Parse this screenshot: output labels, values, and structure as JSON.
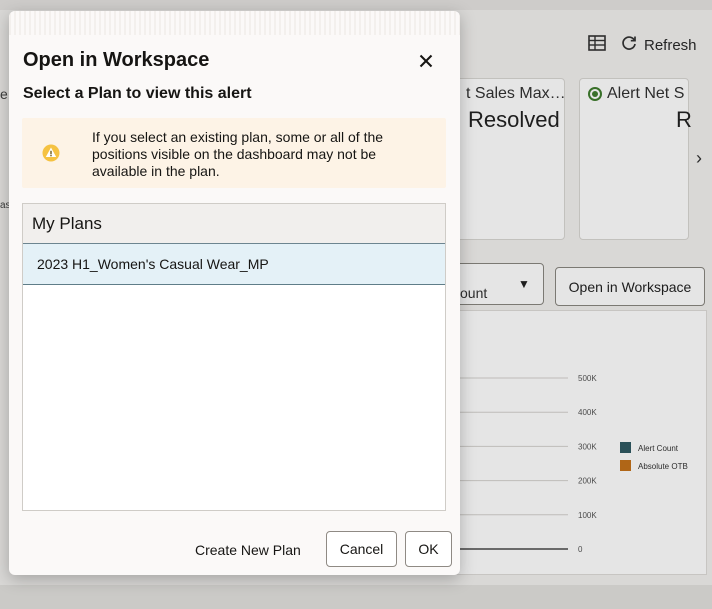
{
  "background": {
    "toolbar": {
      "refresh_label": "Refresh",
      "table_icon": "table-icon",
      "refresh_icon": "refresh-icon"
    },
    "tiles": [
      {
        "title": "t Sales Max…",
        "value": "Resolved"
      },
      {
        "title": "Alert Net S",
        "value": "R"
      }
    ],
    "left_edge": {
      "top_text": "e",
      "mid_text": "as"
    },
    "measure_select": {
      "value": "ount",
      "icon": "chevron-down-icon"
    },
    "open_workspace_label": "Open in Workspace",
    "chart_data": {
      "type": "bar",
      "title": "",
      "yticks": [
        "500K",
        "400K",
        "300K",
        "200K",
        "100K",
        "0"
      ],
      "ylim": [
        0,
        500000
      ],
      "legend_position": "right",
      "series": [
        {
          "name": "Alert Count",
          "color": "#2f5a62"
        },
        {
          "name": "Absolute OTB",
          "color": "#c4721a"
        }
      ]
    }
  },
  "dialog": {
    "title": "Open in Workspace",
    "close_icon": "close-icon",
    "subtitle": "Select a Plan to view this alert",
    "warning": {
      "icon": "warning-icon",
      "text": "If you select an existing plan, some or all of the positions visible on the dashboard may not be available in the plan."
    },
    "plans_header": "My Plans",
    "plans": [
      {
        "label": "2023 H1_Women's Casual Wear_MP",
        "selected": true
      }
    ],
    "buttons": {
      "create": "Create New Plan",
      "cancel": "Cancel",
      "ok": "OK"
    }
  },
  "colors": {
    "selected_row": "#e4f1f7",
    "warning_bg": "#fdf3e6",
    "warning_icon": "#e8b23a"
  }
}
